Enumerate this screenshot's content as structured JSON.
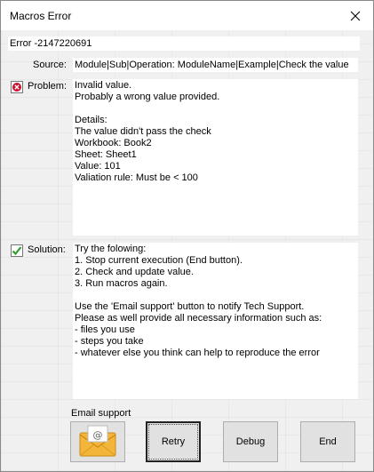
{
  "window": {
    "title": "Macros Error"
  },
  "error": {
    "code_text": "Error -2147220691"
  },
  "source": {
    "label": "Source:",
    "value": "Module|Sub|Operation: ModuleName|Example|Check the value"
  },
  "problem": {
    "label": "Problem:",
    "text": "Invalid value.\nProbably a wrong value provided.\n\nDetails:\nThe value didn't pass the check\nWorkbook: Book2\nSheet: Sheet1\nValue: 101\nValiation rule: Must be < 100"
  },
  "solution": {
    "label": "Solution:",
    "text": "Try the folowing:\n1. Stop current execution (End button).\n2. Check and update value.\n3. Run macros again.\n\nUse the 'Email support' button to notify Tech Support.\nPlease as well provide all necessary information such as:\n- files you use\n- steps you take\n- whatever else you think can help to reproduce the error"
  },
  "buttons": {
    "email_label": "Email support",
    "retry": "Retry",
    "debug": "Debug",
    "end": "End"
  },
  "icons": {
    "close": "close-icon",
    "problem": "error-icon",
    "solution": "checkmark-icon",
    "email": "envelope-at-icon"
  },
  "colors": {
    "error_red": "#c8102e",
    "check_green": "#2e9e2e",
    "envelope": "#f3b63a"
  }
}
